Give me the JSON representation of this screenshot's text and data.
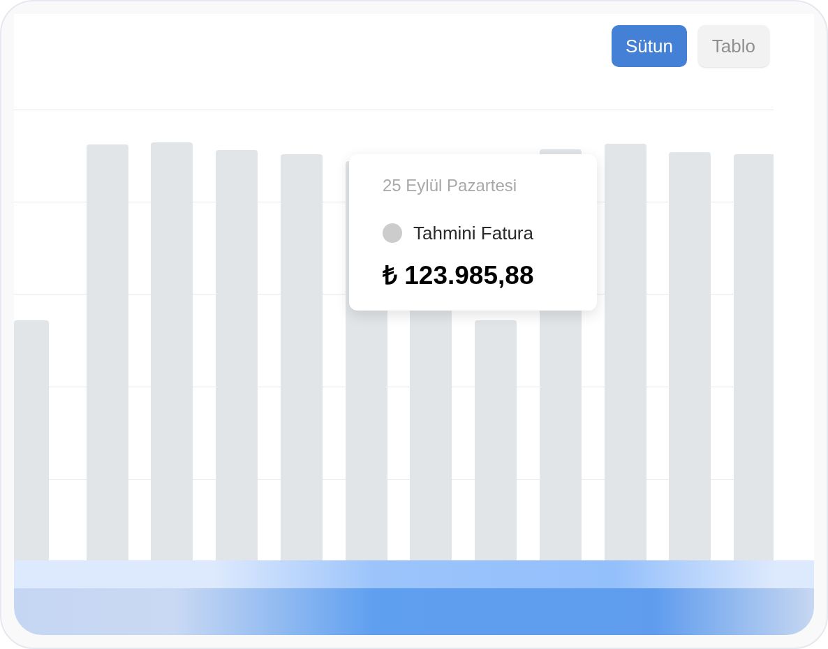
{
  "view_tabs": [
    {
      "label": "Sütun",
      "selected": true
    },
    {
      "label": "Tablo",
      "selected": false
    }
  ],
  "tooltip": {
    "date": "25 Eylül Pazartesi",
    "series": {
      "name": "Tahmini Fatura",
      "color": "#cccccc"
    },
    "value": "₺ 123.985,88"
  }
}
